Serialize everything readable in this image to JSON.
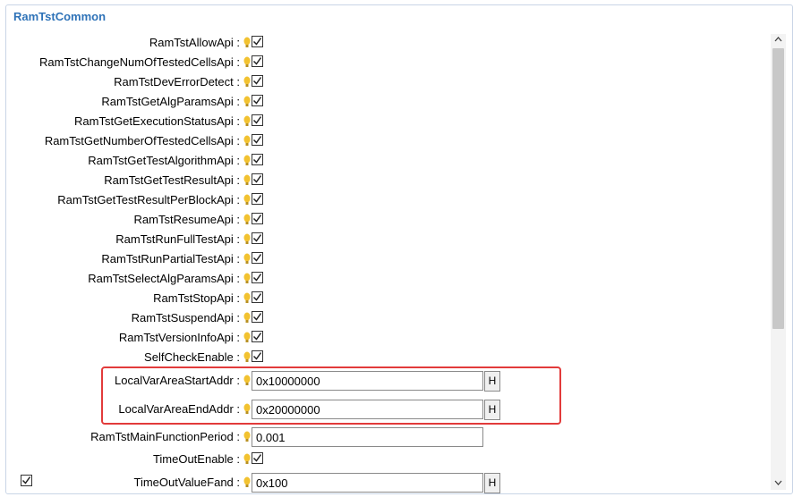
{
  "panel": {
    "title": "RamTstCommon"
  },
  "checkbox_rows": [
    {
      "label": "RamTstAllowApi :",
      "checked": true
    },
    {
      "label": "RamTstChangeNumOfTestedCellsApi :",
      "checked": true
    },
    {
      "label": "RamTstDevErrorDetect :",
      "checked": true
    },
    {
      "label": "RamTstGetAlgParamsApi :",
      "checked": true
    },
    {
      "label": "RamTstGetExecutionStatusApi :",
      "checked": true
    },
    {
      "label": "RamTstGetNumberOfTestedCellsApi :",
      "checked": true
    },
    {
      "label": "RamTstGetTestAlgorithmApi :",
      "checked": true
    },
    {
      "label": "RamTstGetTestResultApi :",
      "checked": true
    },
    {
      "label": "RamTstGetTestResultPerBlockApi :",
      "checked": true
    },
    {
      "label": "RamTstResumeApi :",
      "checked": true
    },
    {
      "label": "RamTstRunFullTestApi :",
      "checked": true
    },
    {
      "label": "RamTstRunPartialTestApi :",
      "checked": true
    },
    {
      "label": "RamTstSelectAlgParamsApi :",
      "checked": true
    },
    {
      "label": "RamTstStopApi :",
      "checked": true
    },
    {
      "label": "RamTstSuspendApi :",
      "checked": true
    },
    {
      "label": "RamTstVersionInfoApi :",
      "checked": true
    },
    {
      "label": "SelfCheckEnable :",
      "checked": true
    }
  ],
  "local_start": {
    "label": "LocalVarAreaStartAddr :",
    "value": "0x10000000",
    "button": "H"
  },
  "local_end": {
    "label": "LocalVarAreaEndAddr :",
    "value": "0x20000000",
    "button": "H"
  },
  "main_period": {
    "label": "RamTstMainFunctionPeriod :",
    "value": "0.001"
  },
  "timeout_enable": {
    "label": "TimeOutEnable :",
    "checked": true
  },
  "timeout_value": {
    "label": "TimeOutValueFand :",
    "value": "0x100",
    "button": "H"
  },
  "scrollbar": {
    "up_arrow": "^",
    "down_arrow": "v"
  },
  "colors": {
    "title": "#2f73b8",
    "highlight": "#e23b3b",
    "bulb": "#f2c230"
  }
}
